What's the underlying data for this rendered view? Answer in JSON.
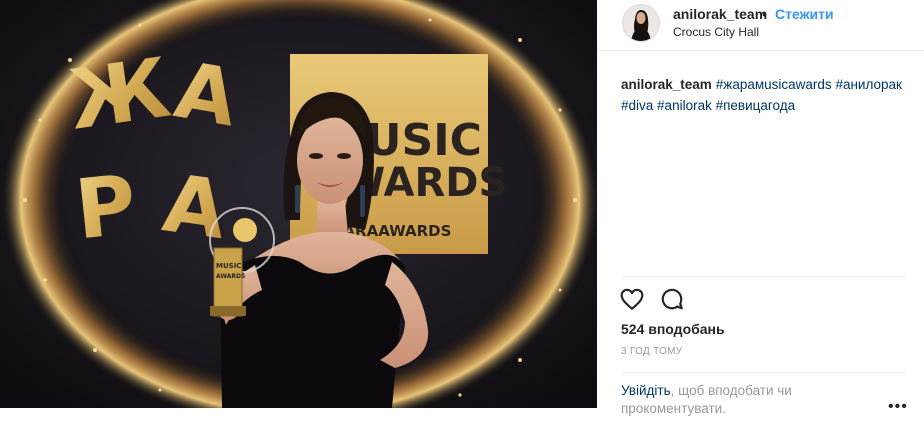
{
  "post": {
    "username": "anilorak_team",
    "separator": "•",
    "follow_label": "Стежити",
    "location": "Crocus City Hall",
    "caption": {
      "username": "anilorak_team",
      "hashtags": [
        "#жарaмusicawards",
        "#анилорак",
        "#diva",
        "#anilorak",
        "#певицагода"
      ]
    },
    "likes": "524 вподобань",
    "time": "3 год тому",
    "login_prompt": {
      "link": "Увійдіть",
      "text": ", щоб вподобати чи прокоментувати."
    },
    "more_label": "•••"
  },
  "photo": {
    "logo_letters": [
      "Ж",
      "А",
      "Р",
      "А"
    ],
    "board_line1": "MUSIC",
    "board_line2": "AWARDS",
    "board_line3": "ZHARAAWARDS",
    "trophy_text_1": "MUSIC",
    "trophy_text_2": "AWARDS"
  },
  "icons": {
    "like": "heart-icon",
    "comment": "comment-bubble-icon",
    "more": "more-options-icon"
  },
  "colors": {
    "link_blue": "#3897f0",
    "hashtag_blue": "#003569",
    "muted": "#999999",
    "gold": "#d8b25a"
  }
}
